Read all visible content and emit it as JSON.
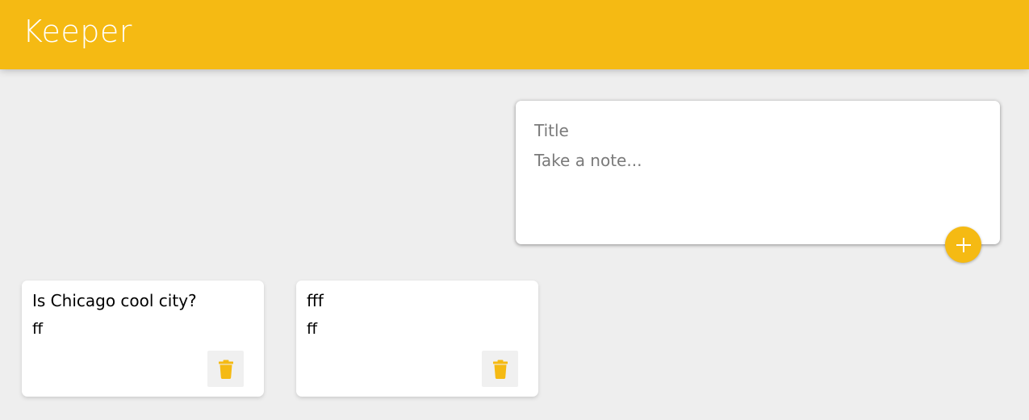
{
  "app": {
    "title": "Keeper",
    "brand_color": "#f5ba13",
    "background_color": "#eeeeee"
  },
  "create_note": {
    "title_placeholder": "Title",
    "title_value": "",
    "content_placeholder": "Take a note...",
    "content_value": "",
    "add_icon": "plus-icon"
  },
  "notes": [
    {
      "title": "Is Chicago cool city?",
      "content": "ff",
      "delete_icon": "trash-icon"
    },
    {
      "title": "fff",
      "content": "ff",
      "delete_icon": "trash-icon"
    }
  ]
}
